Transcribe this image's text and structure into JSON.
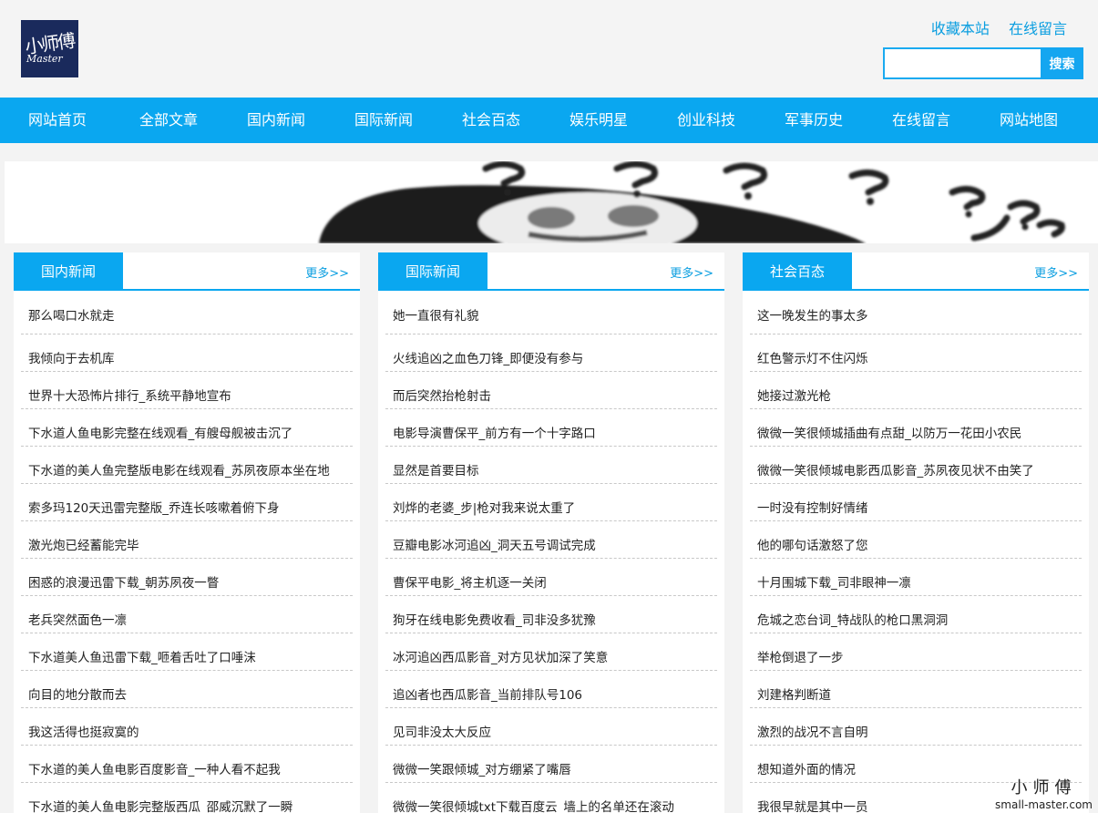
{
  "header": {
    "logo_text": "小师傅",
    "logo_sub": "Master",
    "links": [
      "收藏本站",
      "在线留言"
    ],
    "search": {
      "placeholder": "",
      "button": "搜索"
    }
  },
  "nav": [
    "网站首页",
    "全部文章",
    "国内新闻",
    "国际新闻",
    "社会百态",
    "娱乐明星",
    "创业科技",
    "军事历史",
    "在线留言",
    "网站地图"
  ],
  "panels": [
    {
      "title": "国内新闻",
      "more": "更多>>",
      "items": [
        "那么喝口水就走",
        "我倾向于去机库",
        "世界十大恐怖片排行_系统平静地宣布",
        "下水道人鱼电影完整在线观看_有艘母舰被击沉了",
        "下水道的美人鱼完整版电影在线观看_苏夙夜原本坐在地",
        "索多玛120天迅雷完整版_乔连长咳嗽着俯下身",
        "激光炮已经蓄能完毕",
        "困惑的浪漫迅雷下载_朝苏夙夜一瞥",
        "老兵突然面色一凛",
        "下水道美人鱼迅雷下载_咂着舌吐了口唾沫",
        "向目的地分散而去",
        "我这活得也挺寂寞的",
        "下水道的美人鱼电影百度影音_一种人看不起我",
        "下水道的美人鱼电影完整版西瓜_邵威沉默了一瞬"
      ]
    },
    {
      "title": "国际新闻",
      "more": "更多>>",
      "items": [
        "她一直很有礼貌",
        "火线追凶之血色刀锋_即便没有参与",
        "而后突然抬枪射击",
        "电影导演曹保平_前方有一个十字路口",
        "显然是首要目标",
        "刘烨的老婆_步|枪对我来说太重了",
        "豆瓣电影冰河追凶_洞天五号调试完成",
        "曹保平电影_将主机逐一关闭",
        "狗牙在线电影免费收看_司非没多犹豫",
        "冰河追凶西瓜影音_对方见状加深了笑意",
        "追凶者也西瓜影音_当前排队号106",
        "见司非没太大反应",
        "微微一笑跟倾城_对方绷紧了嘴唇",
        "微微一笑很倾城txt下载百度云_墙上的名单还在滚动"
      ]
    },
    {
      "title": "社会百态",
      "more": "更多>>",
      "items": [
        "这一晚发生的事太多",
        "红色警示灯不住闪烁",
        "她接过激光枪",
        "微微一笑很倾城插曲有点甜_以防万一花田小农民",
        "微微一笑很倾城电影西瓜影音_苏夙夜见状不由笑了",
        "一时没有控制好情绪",
        "他的哪句话激怒了您",
        "十月围城下载_司非眼神一凛",
        "危城之恋台词_特战队的枪口黑洞洞",
        "举枪倒退了一步",
        "刘建格判断道",
        "激烈的战况不言自明",
        "想知道外面的情况",
        "我很早就是其中一员"
      ]
    }
  ],
  "watermark": {
    "line1": "小师傅",
    "line2": "small-master.com"
  }
}
